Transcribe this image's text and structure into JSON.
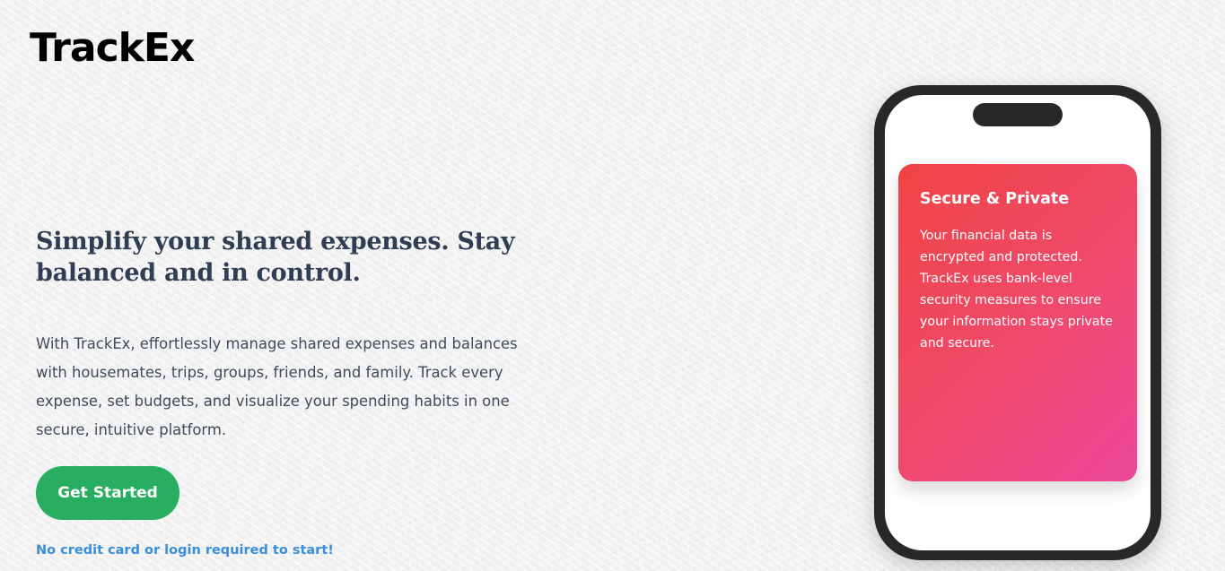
{
  "brand": {
    "name": "TrackEx"
  },
  "hero": {
    "headline": "Simplify your shared expenses. Stay balanced and in control.",
    "description": "With TrackEx, effortlessly manage shared expenses and balances with housemates, trips, groups, friends, and family. Track every expense, set budgets, and visualize your spending habits in one secure, intuitive platform.",
    "cta_label": "Get Started",
    "note": "No credit card or login required to start!"
  },
  "phone": {
    "card": {
      "title": "Secure & Private",
      "text": "Your financial data is encrypted and protected. TrackEx uses bank-level security measures to ensure your information stays private and secure."
    }
  },
  "colors": {
    "cta": "#27ae60",
    "note": "#3b8fd9",
    "card_gradient_start": "#ef4444",
    "card_gradient_end": "#ec4899",
    "phone_frame": "#282828"
  }
}
